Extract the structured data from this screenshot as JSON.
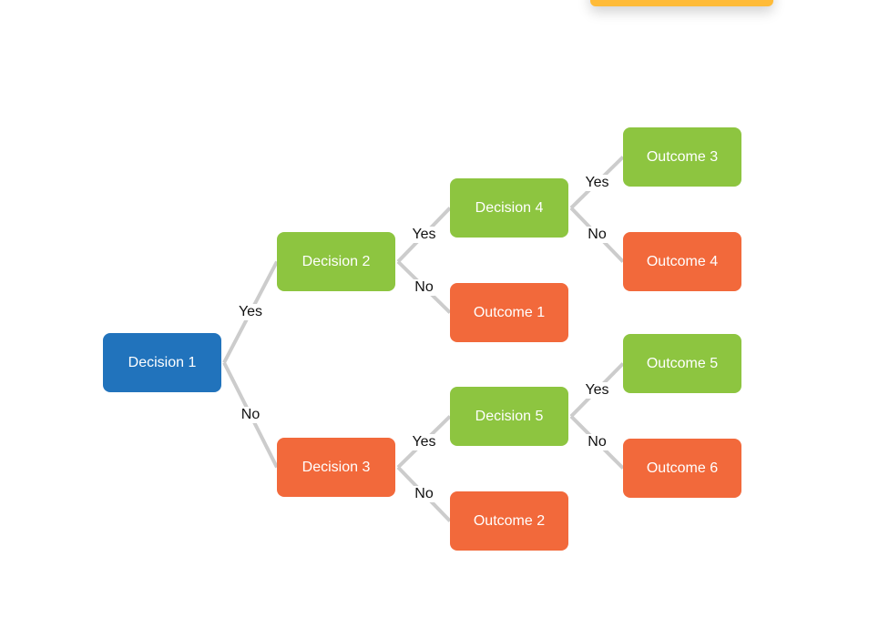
{
  "colors": {
    "decision_root": "#2173BC",
    "positive": "#8DC540",
    "negative": "#F2693B",
    "connector": "#CCCCCC",
    "top_bar": "#FFBB38"
  },
  "nodes": [
    {
      "id": "d1",
      "label": "Decision 1",
      "kind": "root"
    },
    {
      "id": "d2",
      "label": "Decision 2",
      "kind": "positive"
    },
    {
      "id": "d3",
      "label": "Decision 3",
      "kind": "negative"
    },
    {
      "id": "d4",
      "label": "Decision 4",
      "kind": "positive"
    },
    {
      "id": "o1",
      "label": "Outcome 1",
      "kind": "negative"
    },
    {
      "id": "d5",
      "label": "Decision 5",
      "kind": "positive"
    },
    {
      "id": "o2",
      "label": "Outcome 2",
      "kind": "negative"
    },
    {
      "id": "o3",
      "label": "Outcome 3",
      "kind": "positive"
    },
    {
      "id": "o4",
      "label": "Outcome 4",
      "kind": "negative"
    },
    {
      "id": "o5",
      "label": "Outcome 5",
      "kind": "positive"
    },
    {
      "id": "o6",
      "label": "Outcome 6",
      "kind": "negative"
    }
  ],
  "edges": [
    {
      "from": "d1",
      "to": "d2",
      "label": "Yes"
    },
    {
      "from": "d1",
      "to": "d3",
      "label": "No"
    },
    {
      "from": "d2",
      "to": "d4",
      "label": "Yes"
    },
    {
      "from": "d2",
      "to": "o1",
      "label": "No"
    },
    {
      "from": "d3",
      "to": "d5",
      "label": "Yes"
    },
    {
      "from": "d3",
      "to": "o2",
      "label": "No"
    },
    {
      "from": "d4",
      "to": "o3",
      "label": "Yes"
    },
    {
      "from": "d4",
      "to": "o4",
      "label": "No"
    },
    {
      "from": "d5",
      "to": "o5",
      "label": "Yes"
    },
    {
      "from": "d5",
      "to": "o6",
      "label": "No"
    }
  ]
}
